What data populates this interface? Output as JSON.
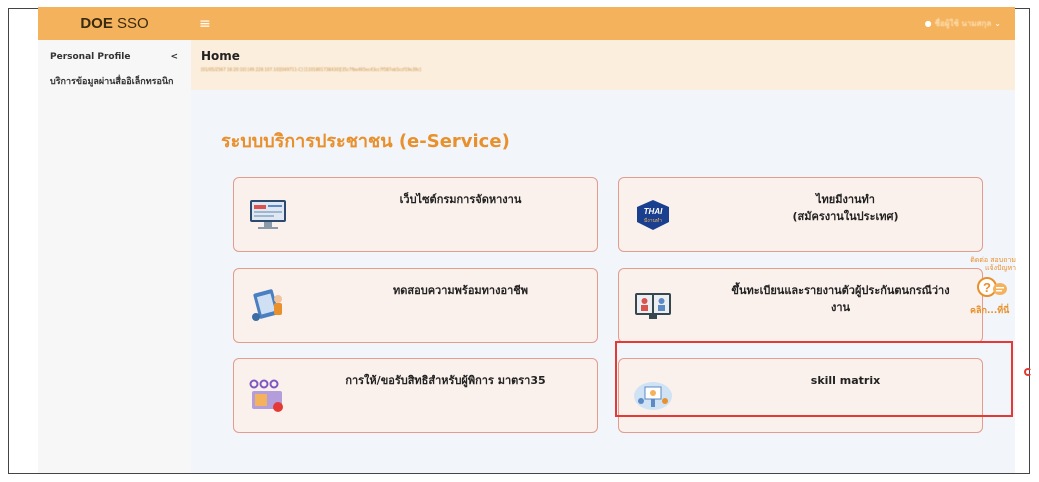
{
  "topbar": {
    "brand_bold": "DOE",
    "brand_light": "SSO",
    "user_name": "ชื่อผู้ใช้ นามสกุล"
  },
  "sidebar": {
    "items": [
      {
        "label": "Personal Profile",
        "chevron": "<"
      },
      {
        "label": "บริการข้อมูลผ่านสื่ออิเล็กทรอนิก",
        "chevron": ""
      }
    ]
  },
  "main": {
    "page_title": "Home",
    "session_info": "[01/05/2567 18:20:10] [49.228.107.10][049711-C] [1101801738430][35c7fbe465ec43cc7f587eb5ccf19e39c]",
    "section_title": "ระบบบริการประชาชน (e-Service)",
    "cards": [
      {
        "label": "เว็บไซต์กรมการจัดหางาน",
        "icon": "website-icon"
      },
      {
        "label": "ไทยมีงานทำ\n(สมัครงานในประเทศ)",
        "icon": "thai-mee-ngan-tam-icon",
        "icon_text_top": "THAI",
        "icon_text_bottom": "มีงานทำ"
      },
      {
        "label": "ทดสอบความพร้อมทางอาชีพ",
        "icon": "career-test-icon"
      },
      {
        "label": "ขึ้นทะเบียนและรายงานตัวผู้ประกันตนกรณีว่าง\nงาน",
        "icon": "unemployment-register-icon"
      },
      {
        "label": "การให้/ขอรับสิทธิสำหรับผู้พิการ มาตรา35",
        "icon": "disability-rights-icon"
      },
      {
        "label": "skill matrix",
        "icon": "skill-matrix-icon"
      }
    ],
    "help": {
      "top_text": "ติดต่อ สอบถาม แจ้งปัญหา",
      "click_text": "คลิก...ที่นี่"
    }
  },
  "colors": {
    "topbar": "#f5b25c",
    "accent": "#e8902c",
    "card_border": "#e39c8e",
    "highlight": "#e53935"
  }
}
